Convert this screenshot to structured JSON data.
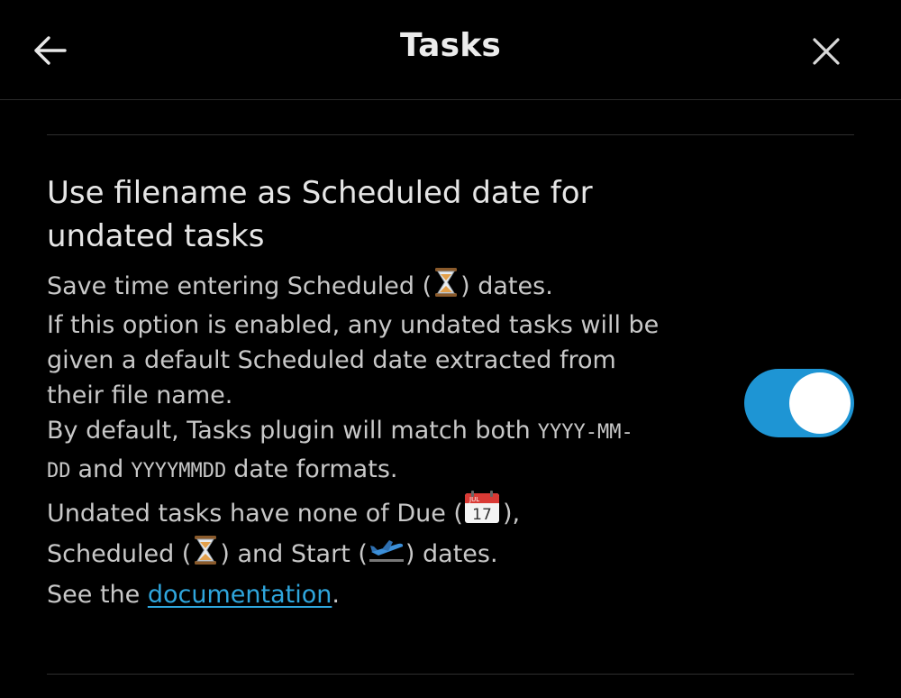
{
  "header": {
    "title": "Tasks",
    "back_icon": "arrow-left-icon",
    "close_icon": "close-icon"
  },
  "setting": {
    "name_line1": "Use filename as Scheduled date for",
    "name_line2": "undated tasks",
    "desc": {
      "l1_a": "Save time entering Scheduled (",
      "l1_b": ") dates.",
      "l2": "If this option is enabled, any undated tasks will be",
      "l3": "given a default Scheduled date extracted from",
      "l4": "their file name.",
      "l5_a": "By default, Tasks plugin will match both",
      "l5_code": "YYYY-MM-",
      "l6_code1": "DD",
      "l6_b": "and",
      "l6_code2": "YYYYMMDD",
      "l6_c": "date formats.",
      "l7_a": "Undated tasks have none of Due (",
      "l7_b": "),",
      "l8_a": "Scheduled (",
      "l8_b": ") and Start (",
      "l8_c": ") dates."
    },
    "see_prefix": "See the ",
    "link_text": "documentation",
    "see_suffix": ".",
    "toggle_on": true,
    "toggle_color": "#1e95d4"
  },
  "icons": {
    "scheduled": "hourglass-icon",
    "due": "calendar-icon",
    "start": "airplane-departure-icon"
  },
  "calendar_label": {
    "month": "JUL",
    "day": "17"
  }
}
